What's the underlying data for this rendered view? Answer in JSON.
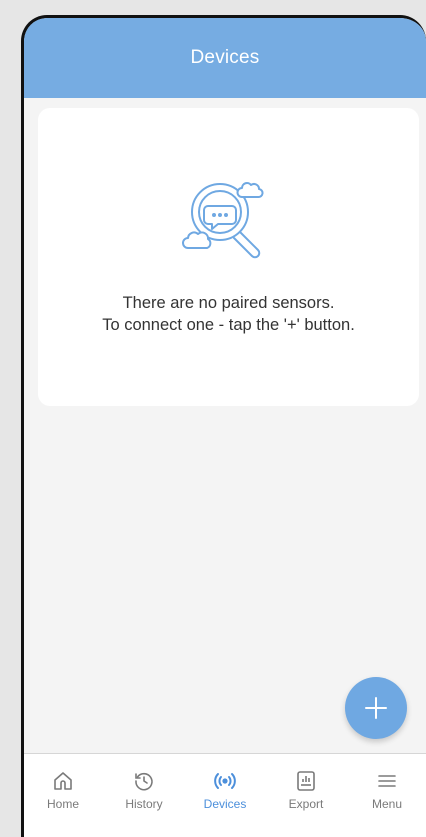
{
  "header": {
    "title": "Devices"
  },
  "empty_state": {
    "icon": "search-chat-cloud-icon",
    "line1": "There are no paired sensors.",
    "line2": "To connect one - tap the '+' button."
  },
  "fab": {
    "icon": "plus-icon",
    "label": "+"
  },
  "bottom_nav": {
    "active": "Devices",
    "items": [
      {
        "label": "Home",
        "icon": "home-icon"
      },
      {
        "label": "History",
        "icon": "history-icon"
      },
      {
        "label": "Devices",
        "icon": "broadcast-icon"
      },
      {
        "label": "Export",
        "icon": "export-icon"
      },
      {
        "label": "Menu",
        "icon": "hamburger-menu-icon"
      }
    ]
  },
  "colors": {
    "header": "#76ace2",
    "accent": "#4c8fdb",
    "fab": "#6fa8e2",
    "background": "#f4f4f4"
  }
}
